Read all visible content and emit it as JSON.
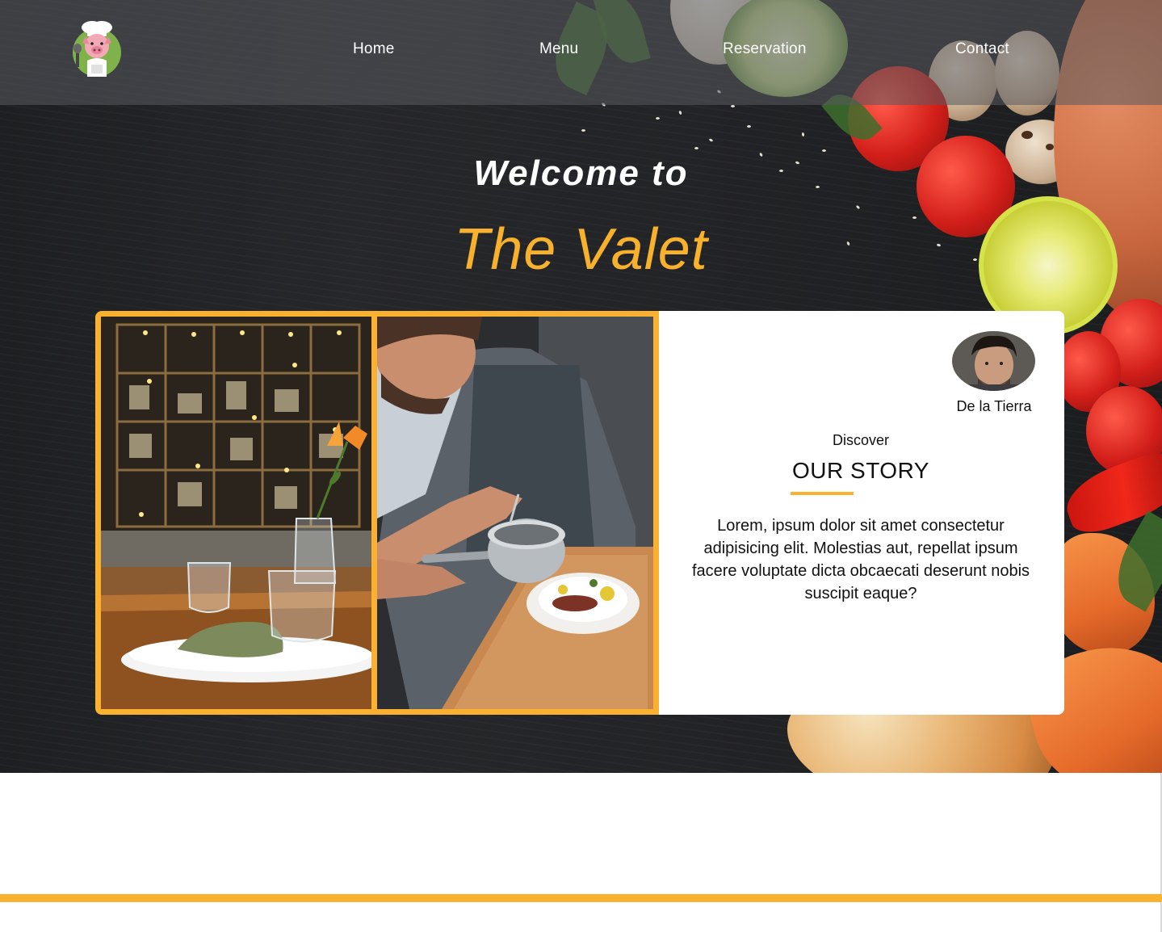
{
  "nav": {
    "logo_alt": "pig chef logo",
    "items": [
      {
        "label": "Home"
      },
      {
        "label": "Menu"
      },
      {
        "label": "Reservation"
      },
      {
        "label": "Contact"
      }
    ]
  },
  "hero": {
    "welcome": "Welcome to",
    "brand": "The Valet"
  },
  "story": {
    "author": "De la Tierra",
    "eyebrow": "Discover",
    "title": "OUR STORY",
    "body": "Lorem, ipsum dolor sit amet consectetur adipisicing elit. Molestias aut, repellat ipsum facere voluptate dicta obcaecati deserunt nobis suscipit eaque?"
  },
  "colors": {
    "accent": "#fbb130",
    "hero_bg": "#232427",
    "text_light": "#ffffff",
    "text_dark": "#111111"
  },
  "icons": {
    "logo": "pig-chef-icon"
  }
}
